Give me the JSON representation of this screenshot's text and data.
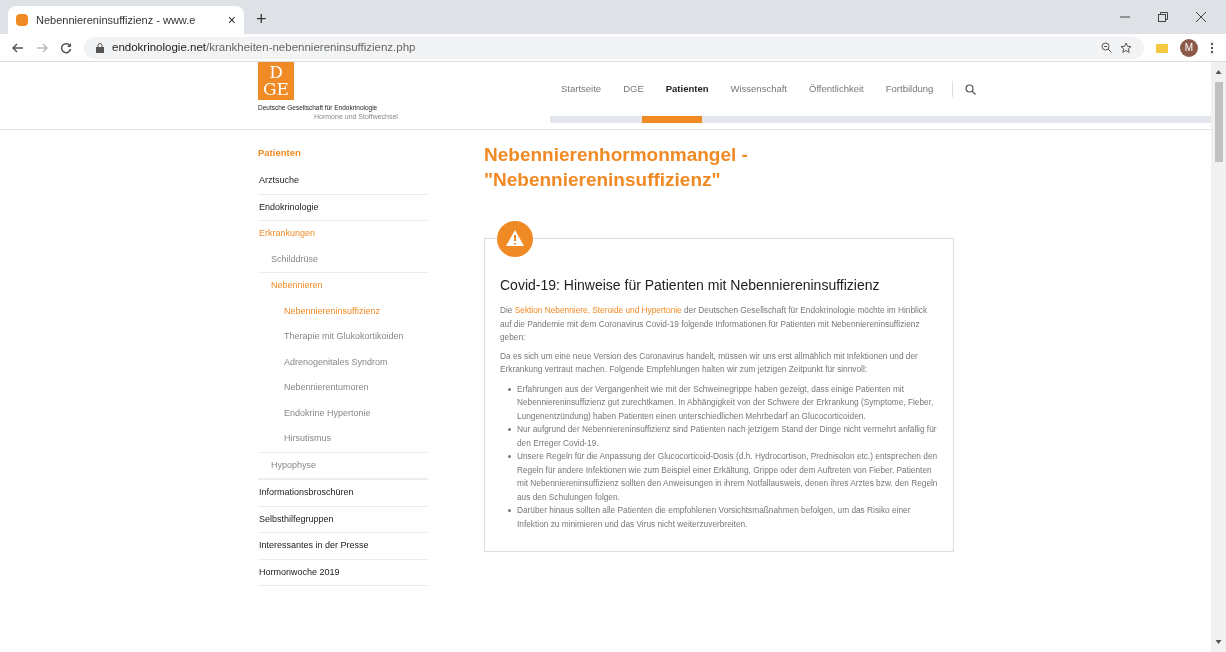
{
  "browser": {
    "tab_title": "Nebenniereninsuffizienz - www.e",
    "tab_close": "×",
    "new_tab": "+",
    "url_host": "endokrinologie.net",
    "url_path": "/krankheiten-nebenniereninsuffizienz.php",
    "avatar": "M"
  },
  "logo": {
    "mark_lines": [
      "D",
      "GE"
    ],
    "name": "Deutsche Gesellschaft für Endokrinologie",
    "tagline": "Hormone und Stoffwechsel"
  },
  "nav": [
    {
      "label": "Startseite",
      "selected": false
    },
    {
      "label": "DGE",
      "selected": false
    },
    {
      "label": "Patienten",
      "selected": true
    },
    {
      "label": "Wissenschaft",
      "selected": false
    },
    {
      "label": "Öffentlichkeit",
      "selected": false
    },
    {
      "label": "Fortbildung",
      "selected": false
    }
  ],
  "sidebar": {
    "heading": "Patienten",
    "items": [
      {
        "label": "Arztsuche",
        "selected": false
      },
      {
        "label": "Endokrinologie",
        "selected": false
      },
      {
        "label": "Erkrankungen",
        "selected": true,
        "children": [
          {
            "label": "Schilddrüse",
            "selected": false
          },
          {
            "label": "Nebennieren",
            "selected": true,
            "children": [
              {
                "label": "Nebenniereninsuffizienz",
                "selected": true
              },
              {
                "label": "Therapie mit Glukokortikoiden",
                "selected": false
              },
              {
                "label": "Adrenogenitales Syndrom",
                "selected": false
              },
              {
                "label": "Nebennierentumoren",
                "selected": false
              },
              {
                "label": "Endokrine Hypertonie",
                "selected": false
              },
              {
                "label": "Hirsutismus",
                "selected": false
              }
            ]
          },
          {
            "label": "Hypophyse",
            "selected": false
          }
        ]
      },
      {
        "label": "Informationsbroschüren",
        "selected": false
      },
      {
        "label": "Selbsthilfegruppen",
        "selected": false
      },
      {
        "label": "Interessantes in der Presse",
        "selected": false
      },
      {
        "label": "Hormonwoche 2019",
        "selected": false
      }
    ]
  },
  "page_title_lines": [
    "Nebennierenhormonmangel -",
    "\"Nebenniereninsuffizienz\""
  ],
  "notice": {
    "title": "Covid-19: Hinweise für Patienten mit Nebenniereninsuffizienz",
    "intro": {
      "before": "Die ",
      "link": "Sektion Nebenniere, Steroide und Hypertonie",
      "after": " der Deutschen Gesellschaft für Endokrinologie möchte im Hinblick auf die Pandemie mit dem Coronavirus Covid-19 folgende Informationen für Patienten mit Nebenniereninsuffizienz geben:"
    },
    "paragraph": "Da es sich um eine neue Version des Coronavirus handelt, müssen wir uns erst allmählich mit Infektionen und der Erkrankung vertraut machen. Folgende Empfehlungen halten wir zum jetzigen Zeitpunkt für sinnvoll:",
    "bullets": [
      "Erfahrungen aus der Vergangenheit wie mit der Schweinegrippe haben gezeigt, dass einige Patienten mit Nebenniereninsuffizienz gut zurechtkamen. In Abhängigkeit von der Schwere der Erkrankung (Symptome, Fieber, Lungenentzündung) haben Patienten einen unterschiedlichen Mehrbedarf an Glucocorticoiden.",
      "Nur aufgrund der Nebenniereninsuffizienz sind Patienten nach jetzigem Stand der Dinge nicht vermehrt anfällig für den Erreger Covid-19.",
      "Unsere Regeln für die Anpassung der Glucocorticoid-Dosis (d.h. Hydrocortison, Prednisolon etc.) entsprechen den Regeln für andere Infektionen wie zum Beispiel einer Erkältung, Grippe oder dem Auftreten von Fieber. Patienten mit Nebenniereninsuffizienz sollten den Anweisungen in ihrem Notfallausweis, denen ihres Arztes bzw. den Regeln aus den Schulungen folgen.",
      "Darüber hinaus sollten alle Patienten die empfohlenen Vorsichtsmaßnahmen befolgen, um das Risiko einer Infektion zu minimieren und das Virus nicht weiterzuverbreiten."
    ]
  }
}
